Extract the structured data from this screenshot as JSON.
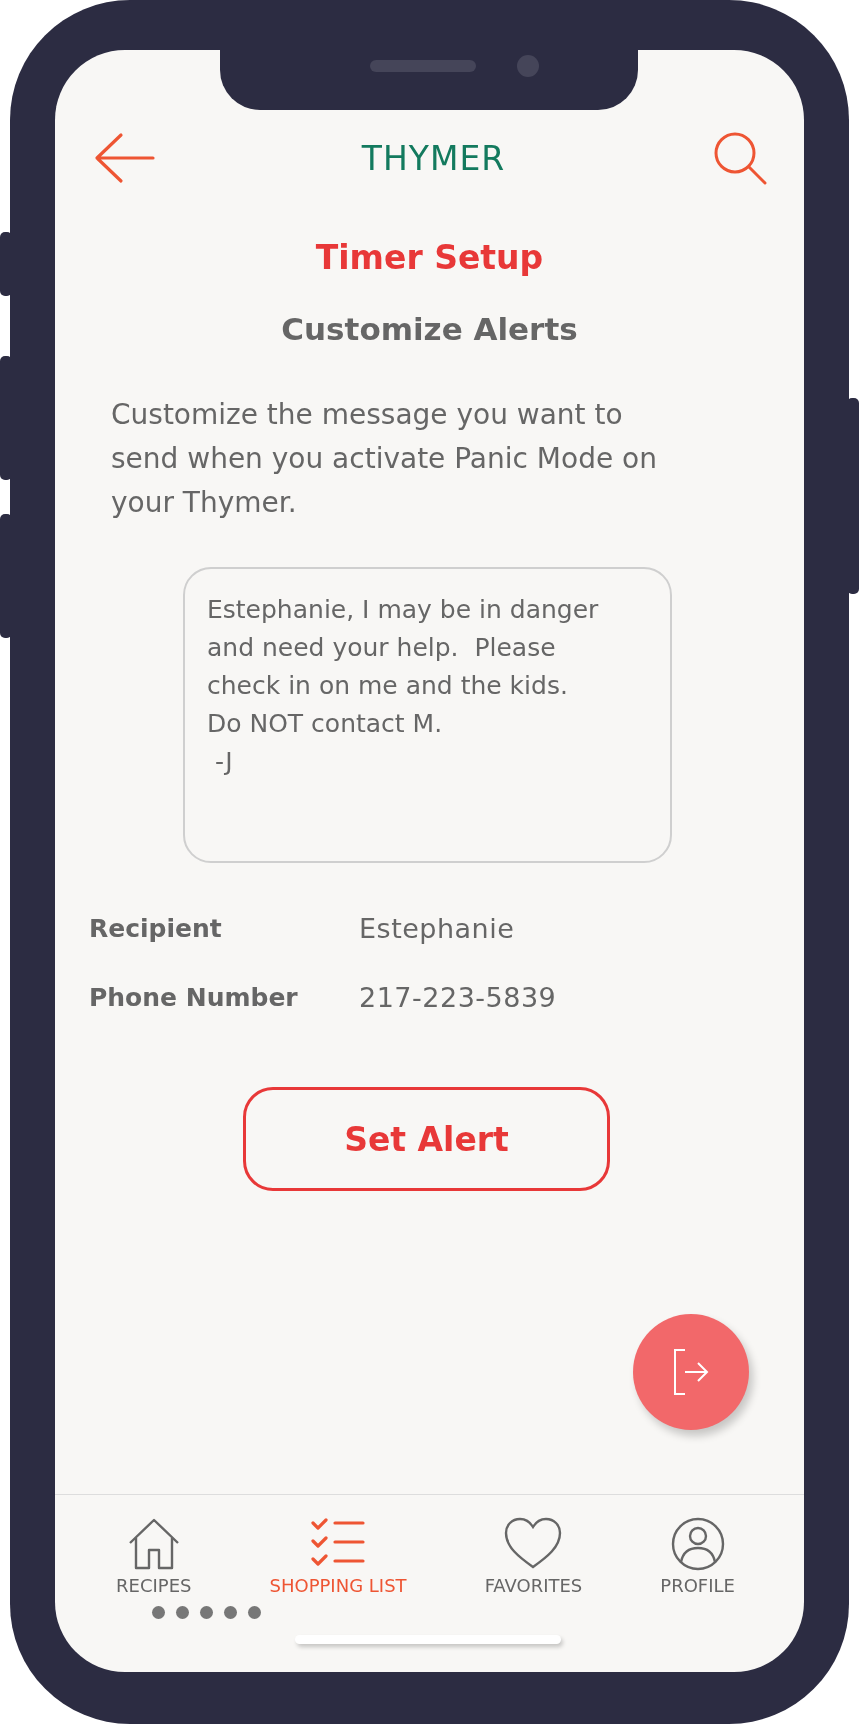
{
  "header": {
    "brand": "THYMER"
  },
  "title": "Timer Setup",
  "subtitle": "Customize Alerts",
  "description": "Customize the message you want to send when you activate Panic Mode on your Thymer.",
  "message": {
    "value": "Estephanie, I may be in danger\nand need your help.  Please\ncheck in on me and the kids.\nDo NOT contact M.\n -J"
  },
  "fields": [
    {
      "label": "Recipient",
      "value": "Estephanie"
    },
    {
      "label": "Phone Number",
      "value": "217-223-5839"
    }
  ],
  "primary_button": "Set Alert",
  "nav": [
    {
      "kind": "home",
      "label": "RECIPES",
      "selected": false
    },
    {
      "kind": "checklist",
      "label": "SHOPPING LIST",
      "selected": true
    },
    {
      "kind": "heart",
      "label": "FAVORITES",
      "selected": false
    },
    {
      "kind": "person",
      "label": "PROFILE",
      "selected": false
    }
  ]
}
